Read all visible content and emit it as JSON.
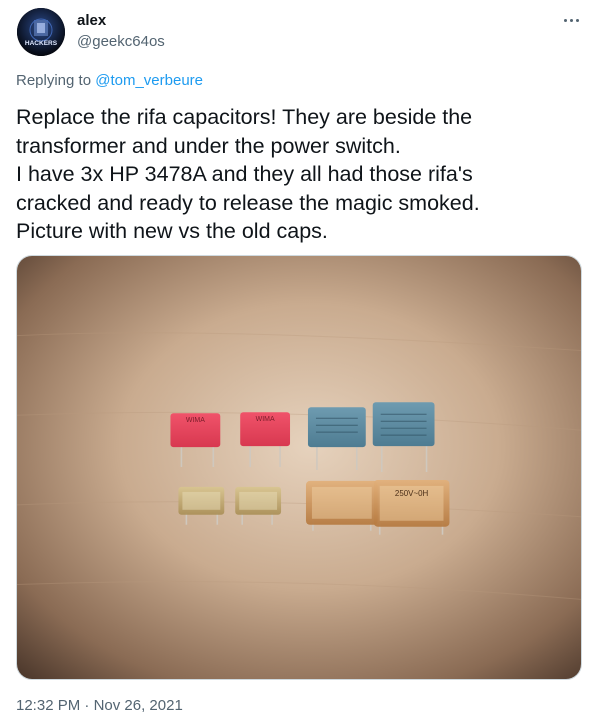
{
  "author": {
    "display_name": "alex",
    "handle": "@geekc64os",
    "avatar_text": "HACKERS"
  },
  "reply": {
    "prefix": "Replying to ",
    "mention": "@tom_verbeure"
  },
  "tweet": {
    "lines": [
      "Replace the rifa capacitors! They are beside the",
      "transformer and under the power switch.",
      "I have 3x HP 3478A and they all had those rifa's",
      "cracked and ready to release the magic smoked.",
      "Picture with new vs the old caps."
    ]
  },
  "photo": {
    "top_row_labels": [
      "WIMA",
      "WIMA",
      "",
      ""
    ],
    "bottom_row_labels": [
      "",
      "",
      "",
      "250V~0H"
    ]
  },
  "meta": {
    "time": "12:32 PM",
    "separator": " · ",
    "date": "Nov 26, 2021"
  },
  "colors": {
    "link": "#1d9bf0",
    "muted": "#536471",
    "text": "#0f1419"
  },
  "icons": {
    "more": "more-dots-icon",
    "avatar": "hackers-avatar-icon"
  }
}
